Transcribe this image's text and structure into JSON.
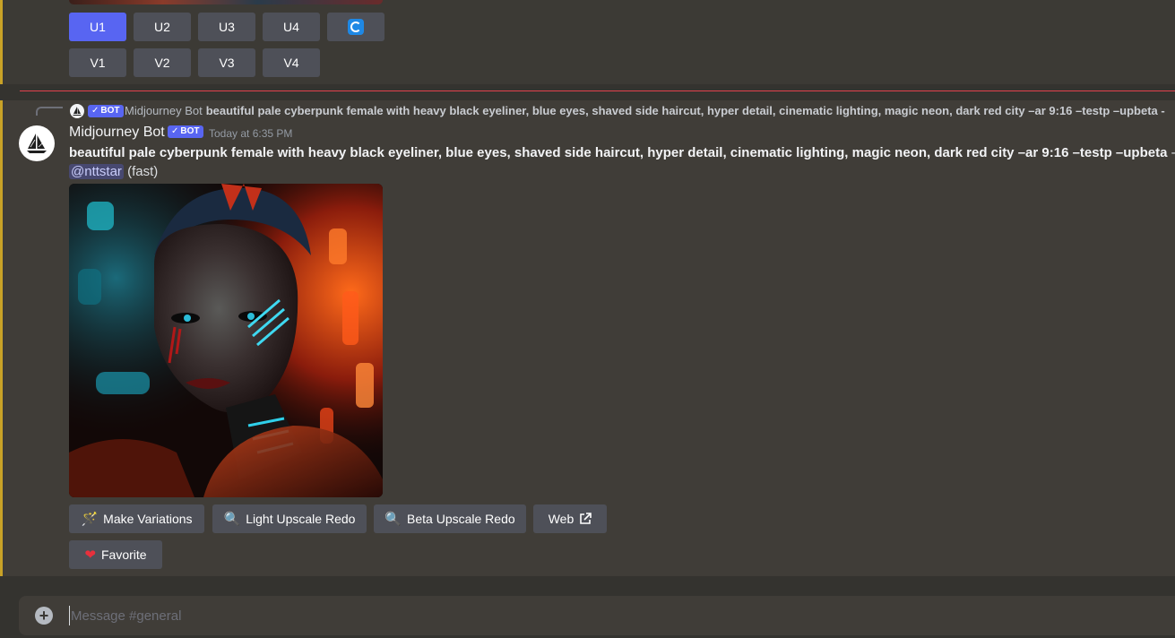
{
  "upscale_buttons": {
    "row1": [
      "U1",
      "U2",
      "U3",
      "U4"
    ],
    "row2": [
      "V1",
      "V2",
      "V3",
      "V4"
    ],
    "reroll_icon": "refresh-icon"
  },
  "reply": {
    "author": "Midjourney Bot",
    "bot_label": "BOT",
    "content": "beautiful pale cyberpunk female with heavy black eyeliner, blue eyes, shaved side haircut, hyper detail, cinematic lighting, magic neon, dark red city –ar 9:16 –testp –upbeta -"
  },
  "message": {
    "author": "Midjourney Bot",
    "bot_label": "BOT",
    "timestamp": "Today at 6:35 PM",
    "prompt_bold": "beautiful pale cyberpunk female with heavy black eyeliner, blue eyes, shaved side haircut, hyper detail, cinematic lighting, magic neon, dark red city –ar 9:16 –testp –upbeta",
    "prompt_suffix": " - U",
    "mention": "@nttstar",
    "speed": "(fast)"
  },
  "actions": {
    "make_variations": "Make Variations",
    "light_upscale_redo": "Light Upscale Redo",
    "beta_upscale_redo": "Beta Upscale Redo",
    "web": "Web",
    "favorite": "Favorite"
  },
  "composer": {
    "placeholder": "Message #general"
  },
  "colors": {
    "accent": "#5865f2",
    "highlight_border": "#c9a227",
    "new_divider": "#e2414d"
  }
}
